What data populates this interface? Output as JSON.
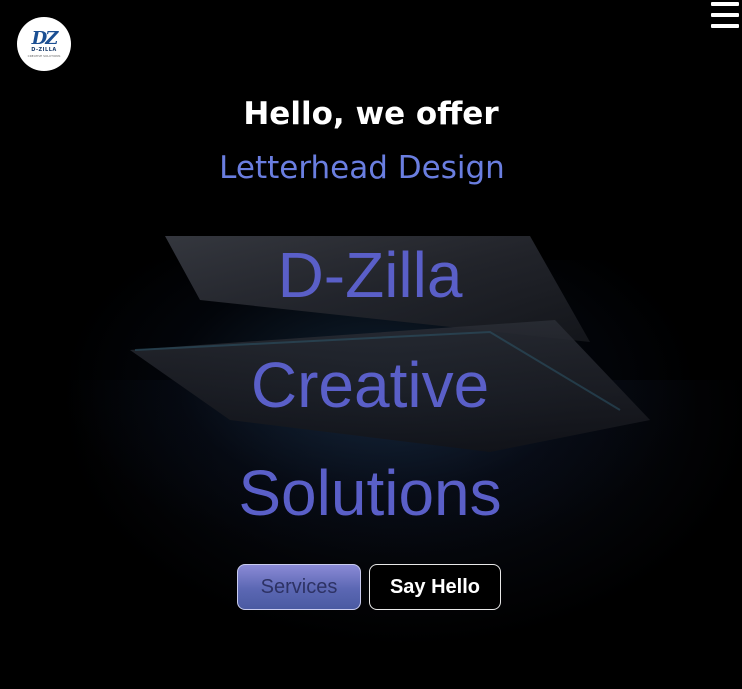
{
  "brand": {
    "logo_mark": "DZ",
    "logo_text": "D-ZILLA",
    "logo_sub": "CREATIVE SOLUTIONS"
  },
  "nav": {
    "menu_icon": "hamburger-menu-icon"
  },
  "hero": {
    "greeting": "Hello, we offer",
    "typed_service": "Letterhead Design",
    "title_line_1": "D-Zilla",
    "title_line_2": "Creative",
    "title_line_3": "Solutions"
  },
  "actions": {
    "services_label": "Services",
    "say_hello_label": "Say Hello"
  },
  "colors": {
    "background": "#000000",
    "accent": "#5a5fc8",
    "typed_text": "#6a7ee0",
    "services_button": "#6b74c4"
  }
}
